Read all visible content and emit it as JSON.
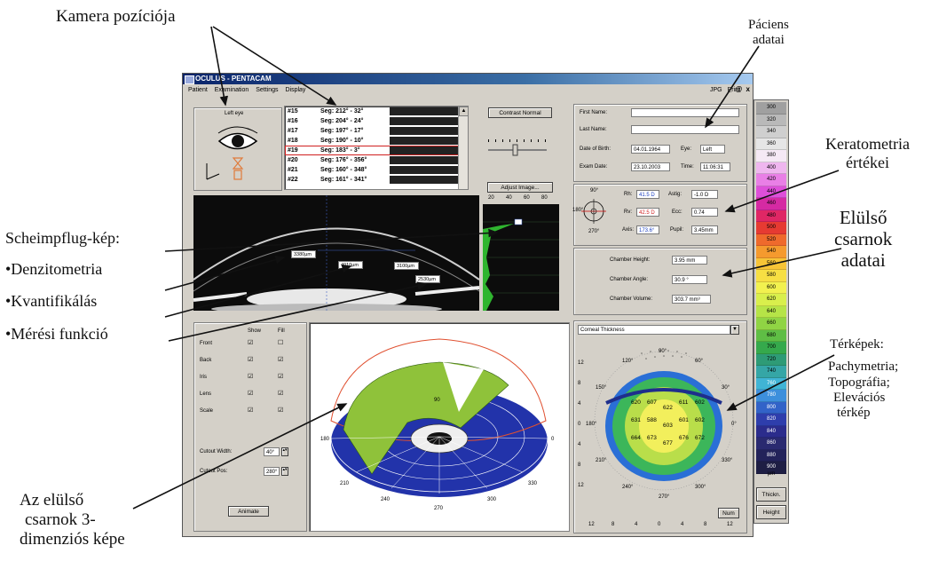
{
  "annotations": {
    "camera": "Kamera pozíciója",
    "patient_line1": "Páciens",
    "patient_line2": "adatai",
    "kerato_line1": "Keratometria",
    "kerato_line2": "értékei",
    "chamber_line1": "Elülső",
    "chamber_line2": "csarnok",
    "chamber_line3": "adatai",
    "maps_title": "Térképek:",
    "maps_line1": "Pachymetria;",
    "maps_line2": "Topográfia;",
    "maps_line3": "Elevációs",
    "maps_line4": "térkép",
    "scheimpflug": "Scheimpflug-kép:",
    "bullet1": "•Denzitometria",
    "bullet2": "•Kvantifikálás",
    "bullet3": "•Mérési funkció",
    "three_d_line1": "Az elülső",
    "three_d_line2": "csarnok 3-",
    "three_d_line3": "dimenziós képe"
  },
  "window": {
    "title": "OCULUS - PENTACAM",
    "menu": [
      "Patient",
      "Examination",
      "Settings",
      "Display"
    ],
    "menu_right": [
      "JPG",
      "Print"
    ],
    "controls": "_ @ x"
  },
  "eye_panel": {
    "label": "Left eye"
  },
  "segments": [
    {
      "id": "#15",
      "seg": "Seg: 212° - 32°"
    },
    {
      "id": "#16",
      "seg": "Seg: 204° - 24°"
    },
    {
      "id": "#17",
      "seg": "Seg: 197° - 17°"
    },
    {
      "id": "#18",
      "seg": "Seg: 190° - 10°"
    },
    {
      "id": "#19",
      "seg": "Seg: 183° - 3°"
    },
    {
      "id": "#20",
      "seg": "Seg: 176° - 356°"
    },
    {
      "id": "#21",
      "seg": "Seg: 160° - 348°"
    },
    {
      "id": "#22",
      "seg": "Seg: 161° - 341°"
    }
  ],
  "buttons": {
    "contrast": "Contrast Normal",
    "adjust": "Adjust Image...",
    "animate": "Animate",
    "num": "Num"
  },
  "patient": {
    "first_name_label": "First Name:",
    "first_name": "",
    "last_name_label": "Last Name:",
    "last_name": "",
    "dob_label": "Date of Birth:",
    "dob": "04.01.1964",
    "eye_label": "Eye:",
    "eye": "Left",
    "exam_label": "Exam Date:",
    "exam_date": "23.10.2003",
    "time_label": "Time:",
    "time": "11:06:31"
  },
  "kerato": {
    "rh_label": "Rh:",
    "rh": "41.5 D",
    "rv_label": "Rv:",
    "rv": "42.5 D",
    "axis_label": "Axis:",
    "axis": "173.6°",
    "astig_label": "Astig:",
    "astig": "-1.0 D",
    "ecc_label": "Ecc:",
    "ecc": "0.74",
    "pupil_label": "Pupil:",
    "pupil": "3.45mm",
    "dial": {
      "top": "90°",
      "left": "180°",
      "bottom": "270°"
    }
  },
  "chamber": {
    "height_label": "Chamber Height:",
    "height": "3.95 mm",
    "angle_label": "Chamber Angle:",
    "angle": "30.9 °",
    "volume_label": "Chamber Volume:",
    "volume": "303.7 mm³"
  },
  "scheimpflug": {
    "measures": [
      "3380µm",
      "4010µm",
      "3100µm",
      "2530µm"
    ],
    "density_ticks": [
      "20",
      "40",
      "60",
      "80"
    ],
    "density_value": "ᴗ"
  },
  "display_options": {
    "show_label": "Show",
    "fill_label": "Fill",
    "rows": [
      {
        "name": "Front",
        "show": "☑",
        "fill": "☐"
      },
      {
        "name": "Back",
        "show": "☑",
        "fill": "☑"
      },
      {
        "name": "Iris",
        "show": "☑",
        "fill": "☑"
      },
      {
        "name": "Lens",
        "show": "☑",
        "fill": "☑"
      },
      {
        "name": "Scale",
        "show": "☑",
        "fill": "☑"
      }
    ],
    "cutout_width_label": "Cutout Width:",
    "cutout_width": "40°",
    "cutout_pos_label": "Cutout Pos:",
    "cutout_pos": "280°"
  },
  "three_d": {
    "angles": [
      "90",
      "0",
      "330",
      "300",
      "270",
      "240",
      "210",
      "180"
    ]
  },
  "map": {
    "select": "Corneal Thickness",
    "y_ticks": [
      "12",
      "8",
      "4",
      "0",
      "4",
      "8",
      "12"
    ],
    "x_ticks": [
      "12",
      "8",
      "4",
      "0",
      "4",
      "8",
      "12"
    ],
    "ring_labels": [
      "90°",
      "60°",
      "30°",
      "0°",
      "330°",
      "300°",
      "270°",
      "240°",
      "210°",
      "180°",
      "150°",
      "120°"
    ],
    "values": [
      {
        "v": "620"
      },
      {
        "v": "607"
      },
      {
        "v": "622"
      },
      {
        "v": "611"
      },
      {
        "v": "602"
      },
      {
        "v": "631"
      },
      {
        "v": "588"
      },
      {
        "v": "603"
      },
      {
        "v": "601"
      },
      {
        "v": "602"
      },
      {
        "v": "664"
      },
      {
        "v": "673"
      },
      {
        "v": "677"
      },
      {
        "v": "676"
      },
      {
        "v": "672"
      }
    ]
  },
  "color_scale": {
    "values": [
      "300",
      "320",
      "340",
      "360",
      "380",
      "400",
      "420",
      "440",
      "460",
      "480",
      "500",
      "520",
      "540",
      "560",
      "580",
      "600",
      "620",
      "640",
      "660",
      "680",
      "700",
      "720",
      "740",
      "760",
      "780",
      "800",
      "820",
      "840",
      "860",
      "880",
      "900"
    ],
    "colors": [
      "#a0a0a0",
      "#b9b9b9",
      "#cfcfcf",
      "#e6e6e6",
      "#f5e9f5",
      "#efb6ef",
      "#e97fe6",
      "#de4fd9",
      "#d52aa3",
      "#df2765",
      "#e63a32",
      "#ef6a2c",
      "#f59a2e",
      "#f7c437",
      "#f7df43",
      "#f2f14f",
      "#d9ef4c",
      "#b6e447",
      "#90d444",
      "#5fbe45",
      "#35a94c",
      "#2e9b76",
      "#35a6a6",
      "#40b4d5",
      "#3d8fdc",
      "#3263c8",
      "#2e3eac",
      "#2b2c8c",
      "#2a2a70",
      "#23235a",
      "#1e1e44"
    ],
    "unit": "µm",
    "thick": "Thickn.",
    "height": "Height"
  }
}
